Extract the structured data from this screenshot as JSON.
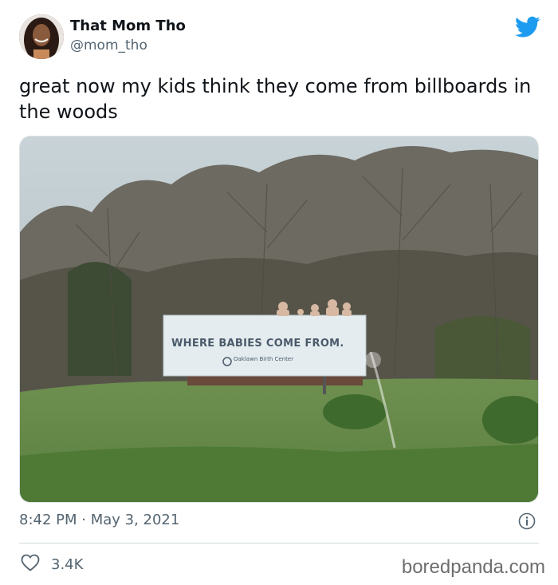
{
  "author": {
    "name": "That Mom Tho",
    "handle": "@mom_tho",
    "avatar_icon": "avatar-photo"
  },
  "tweet": {
    "text": "great now my kids think they come from billboards in the woods"
  },
  "photo": {
    "billboard_headline": "WHERE BABIES COME FROM.",
    "billboard_subline": "Oaklawn Birth Center"
  },
  "meta": {
    "timestamp": "8:42 PM · May 3, 2021"
  },
  "engagement": {
    "likes": "3.4K"
  },
  "watermark": "boredpanda.com",
  "colors": {
    "twitter_blue": "#1d9bf0",
    "text_primary": "#0f1419",
    "text_secondary": "#536471"
  }
}
